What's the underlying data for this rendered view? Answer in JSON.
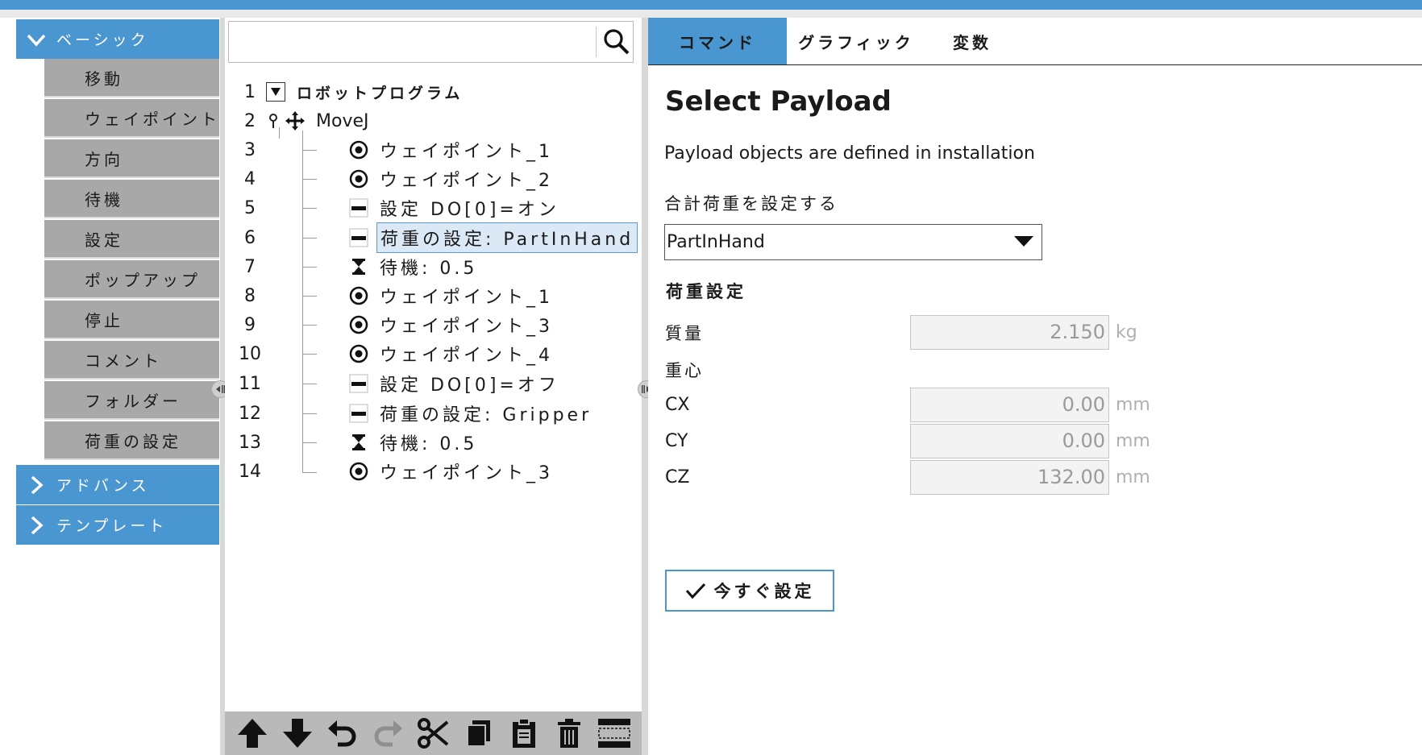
{
  "sidebar": {
    "basic_label": "ベーシック",
    "items": [
      {
        "label": "移動"
      },
      {
        "label": "ウェイポイント"
      },
      {
        "label": "方向"
      },
      {
        "label": "待機"
      },
      {
        "label": "設定"
      },
      {
        "label": "ポップアップ"
      },
      {
        "label": "停止"
      },
      {
        "label": "コメント"
      },
      {
        "label": "フォルダー"
      },
      {
        "label": "荷重の設定"
      }
    ],
    "advanced_label": "アドバンス",
    "template_label": "テンプレート"
  },
  "search": {
    "value": "",
    "icon": "search-icon"
  },
  "tree": {
    "rows": [
      {
        "num": "1",
        "label": "ロボットプログラム",
        "icon": "collapse-triangle-icon"
      },
      {
        "num": "2",
        "label": "MoveJ",
        "icon": "move-cross-icon"
      },
      {
        "num": "3",
        "label": "ウェイポイント_1",
        "icon": "waypoint-icon"
      },
      {
        "num": "4",
        "label": "ウェイポイント_2",
        "icon": "waypoint-icon"
      },
      {
        "num": "5",
        "label": "設定 DO[0]=オン",
        "icon": "set-icon"
      },
      {
        "num": "6",
        "label": "荷重の設定: PartInHand",
        "icon": "set-icon",
        "selected": true
      },
      {
        "num": "7",
        "label": "待機: 0.5",
        "icon": "hourglass-icon"
      },
      {
        "num": "8",
        "label": "ウェイポイント_1",
        "icon": "waypoint-icon"
      },
      {
        "num": "9",
        "label": "ウェイポイント_3",
        "icon": "waypoint-icon"
      },
      {
        "num": "10",
        "label": "ウェイポイント_4",
        "icon": "waypoint-icon"
      },
      {
        "num": "11",
        "label": "設定 DO[0]=オフ",
        "icon": "set-icon"
      },
      {
        "num": "12",
        "label": "荷重の設定: Gripper",
        "icon": "set-icon"
      },
      {
        "num": "13",
        "label": "待機: 0.5",
        "icon": "hourglass-icon"
      },
      {
        "num": "14",
        "label": "ウェイポイント_3",
        "icon": "waypoint-icon"
      }
    ]
  },
  "toolbar": {
    "icons": [
      "move-up-icon",
      "move-down-icon",
      "undo-icon",
      "redo-icon",
      "cut-icon",
      "copy-icon",
      "paste-icon",
      "delete-icon",
      "suppress-icon"
    ]
  },
  "tabs": [
    {
      "label": "コマンド",
      "active": true
    },
    {
      "label": "グラフィック"
    },
    {
      "label": "変数"
    }
  ],
  "panel": {
    "title": "Select Payload",
    "description": "Payload objects are defined in installation",
    "set_total_payload_label": "合計荷重を設定する",
    "dropdown_value": "PartInHand",
    "section_label": "荷重設定",
    "mass_label": "質量",
    "mass_value": "2.150",
    "mass_unit": "kg",
    "cog_label": "重心",
    "cx_label": "CX",
    "cx_value": "0.00",
    "cy_label": "CY",
    "cy_value": "0.00",
    "cz_label": "CZ",
    "cz_value": "132.00",
    "length_unit": "mm",
    "set_now_button": "今すぐ設定"
  },
  "colors": {
    "accent": "#4a96d0",
    "menu_item_bg": "#a8a8a8",
    "toolbar_bg": "#b9b9b9"
  }
}
